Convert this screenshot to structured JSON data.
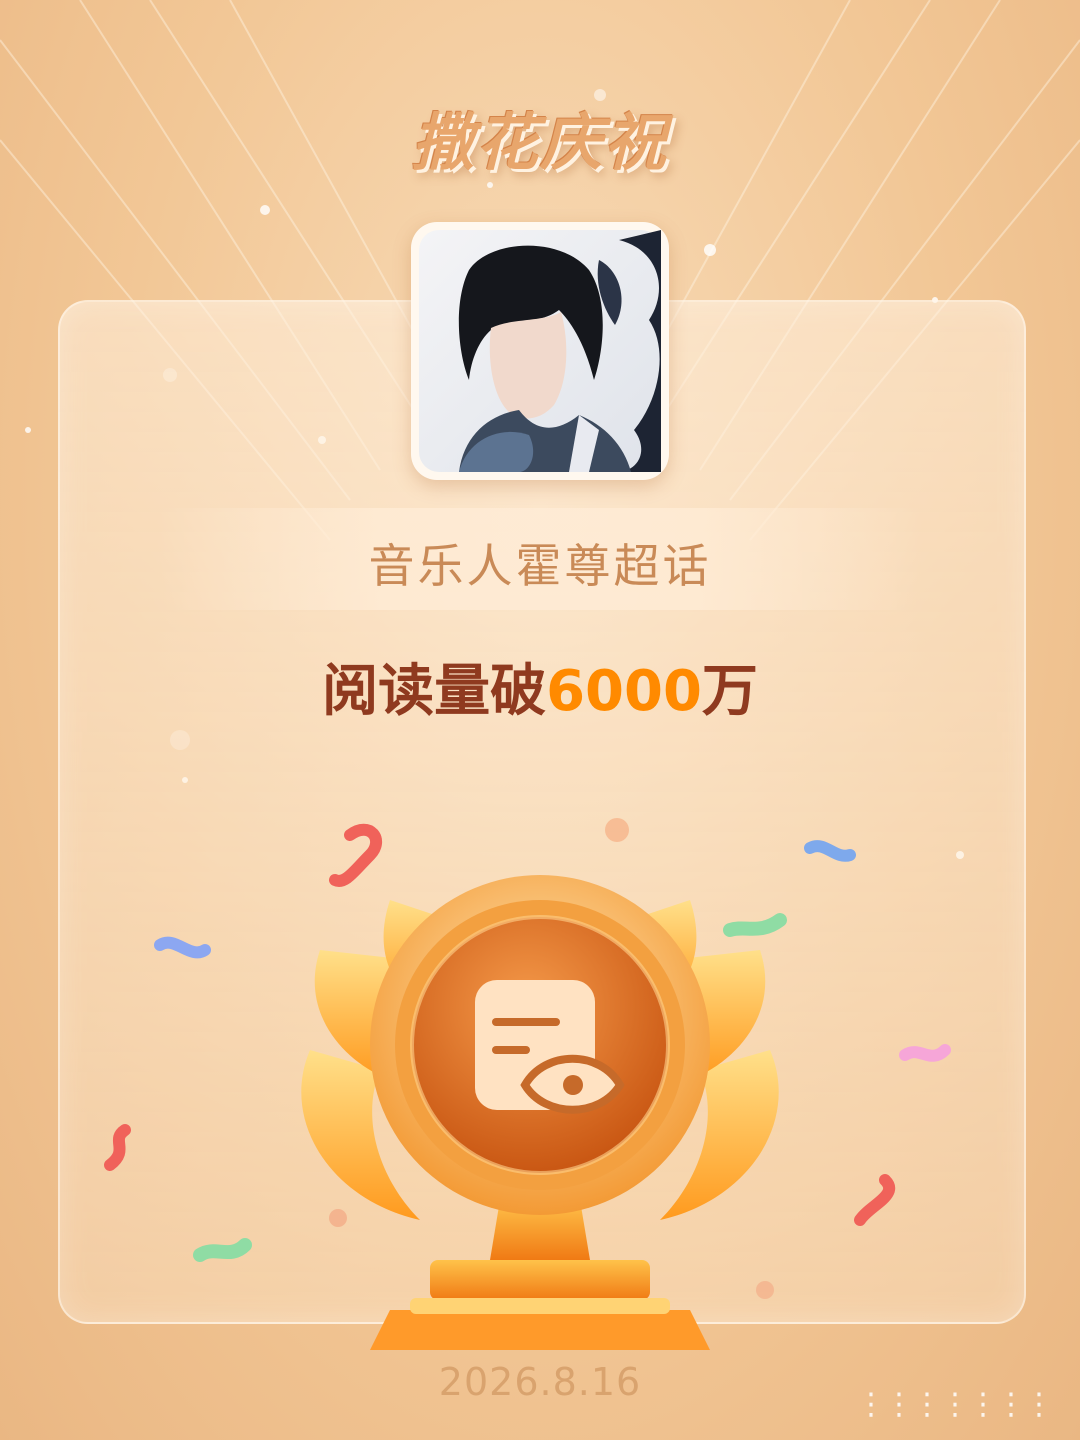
{
  "header": {
    "title": "撒花庆祝"
  },
  "profile": {
    "avatar_icon": "user-avatar-photo"
  },
  "topic": {
    "name": "音乐人霍尊超话"
  },
  "milestone": {
    "prefix": "阅读量破",
    "number": "6000",
    "suffix": "万"
  },
  "trophy": {
    "icon": "document-eye-icon"
  },
  "footer": {
    "date": "2026.8.16"
  },
  "watermark": {
    "text": "⋮⋮⋮⋮⋮⋮⋮"
  },
  "colors": {
    "background": "#f2c796",
    "title": "#e8a66c",
    "topic_text": "#c98a57",
    "milestone_text": "#8f3a1f",
    "milestone_number": "#ff8a00",
    "trophy_orange": "#e8761e",
    "trophy_gold": "#ffb62e"
  }
}
